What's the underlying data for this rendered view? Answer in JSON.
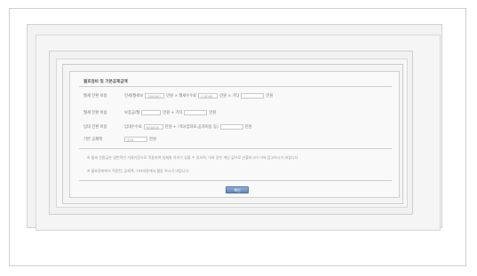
{
  "dialog": {
    "title": "월호정비 및 기본공제금액"
  },
  "rows": [
    {
      "label": "월세 전환 비용",
      "t1": "전세/월세보",
      "v1": "000000",
      "t2": "만원 × 월세수수료",
      "v2": "0.0000",
      "t3": "만원 × 기타",
      "v3": "",
      "t4": "만원"
    },
    {
      "label": "월세 전환 비용",
      "t1": "보증금/월",
      "v1": "",
      "t2": "만원 + 기타",
      "v2": "",
      "t3": "만원"
    },
    {
      "label": "임대 전환 비용",
      "t1": "임대수수료",
      "v1": "000000",
      "t2": "만원 + 기타(임대료,공과비용 등)",
      "v2": "",
      "t3": "만원"
    },
    {
      "label": "기본 공제액",
      "v1": "250",
      "t2": "만원"
    }
  ],
  "notes": [
    "※ 월세 전환금은 일반적인 거래기준으로 적용하며 실제와 차이가 있을 수 있으며, 이와 같은 계산 값으로 산출하시어 이에 참고하시기 바랍니다.",
    "※ 월호정비에서 적용된, 공제액, 기타비용에서 활동 하시기 바랍니다."
  ],
  "button": {
    "label": "확인"
  }
}
